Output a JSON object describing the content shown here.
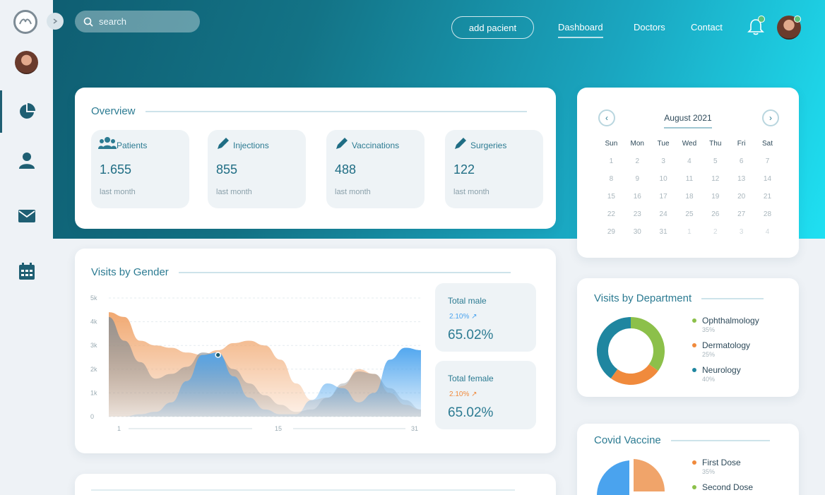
{
  "search": {
    "placeholder": "search"
  },
  "topnav": {
    "add_patient": "add pacient",
    "links": [
      "Dashboard",
      "Doctors",
      "Contact"
    ]
  },
  "overview": {
    "title": "Overview",
    "stats": [
      {
        "label": "Patients",
        "value": "1.655",
        "sub": "last month",
        "icon": "users-icon"
      },
      {
        "label": "Injections",
        "value": "855",
        "sub": "last month",
        "icon": "pencil-icon"
      },
      {
        "label": "Vaccinations",
        "value": "488",
        "sub": "last month",
        "icon": "pencil-icon"
      },
      {
        "label": "Surgeries",
        "value": "122",
        "sub": "last month",
        "icon": "pencil-icon"
      }
    ]
  },
  "calendar": {
    "month": "August 2021",
    "weekdays": [
      "Sun",
      "Mon",
      "Tue",
      "Wed",
      "Thu",
      "Fri",
      "Sat"
    ],
    "weeks": [
      [
        "1",
        "2",
        "3",
        "4",
        "5",
        "6",
        "7"
      ],
      [
        "8",
        "9",
        "10",
        "11",
        "12",
        "13",
        "14"
      ],
      [
        "15",
        "16",
        "17",
        "18",
        "19",
        "20",
        "21"
      ],
      [
        "22",
        "23",
        "24",
        "25",
        "26",
        "27",
        "28"
      ],
      [
        "29",
        "30",
        "31",
        "1",
        "2",
        "3",
        "4"
      ]
    ]
  },
  "visits_gender": {
    "title": "Visits by Gender",
    "male": {
      "title": "Total male",
      "pct": "2.10%",
      "value": "65.02%"
    },
    "female": {
      "title": "Total female",
      "pct": "2.10%",
      "value": "65.02%"
    }
  },
  "chart_data": {
    "type": "area",
    "x": [
      1,
      2,
      3,
      4,
      5,
      6,
      7,
      8,
      9,
      10,
      11,
      12,
      13,
      14,
      15,
      16,
      17,
      18,
      19,
      20,
      21
    ],
    "x_ticks": [
      "1",
      "15",
      "31"
    ],
    "y_ticks": [
      "0",
      "1k",
      "2k",
      "3k",
      "4k",
      "5k"
    ],
    "ylim": [
      0,
      5000
    ],
    "series": [
      {
        "color": "#f0a46a",
        "values": [
          4400,
          4200,
          3200,
          3000,
          2900,
          2700,
          2600,
          2800,
          3100,
          3200,
          3000,
          2400,
          1400,
          700,
          800,
          1300,
          2000,
          1800,
          1000,
          500,
          300
        ]
      },
      {
        "color": "#8a8f93",
        "values": [
          4200,
          3200,
          2300,
          1600,
          1800,
          2100,
          2700,
          2600,
          2000,
          1400,
          900,
          500,
          200,
          300,
          800,
          1400,
          1900,
          1800,
          1200,
          700,
          300
        ]
      },
      {
        "color": "#4aa3ee",
        "values": [
          0,
          0,
          100,
          200,
          600,
          1500,
          2600,
          2700,
          1700,
          800,
          300,
          100,
          100,
          700,
          1400,
          1200,
          600,
          1000,
          2400,
          2900,
          2800
        ]
      }
    ]
  },
  "department": {
    "title": "Visits by Department",
    "items": [
      {
        "name": "Ophthalmology",
        "pct": "35%",
        "value": 35,
        "color": "#8cc04a"
      },
      {
        "name": "Dermatology",
        "pct": "25%",
        "value": 25,
        "color": "#f08a3c"
      },
      {
        "name": "Neurology",
        "pct": "40%",
        "value": 40,
        "color": "#1f86a0"
      }
    ]
  },
  "covid": {
    "title": "Covid Vaccine",
    "items": [
      {
        "name": "First Dose",
        "pct": "35%",
        "color": "#f08a3c"
      },
      {
        "name": "Second Dose",
        "color": "#8cc04a"
      }
    ]
  }
}
